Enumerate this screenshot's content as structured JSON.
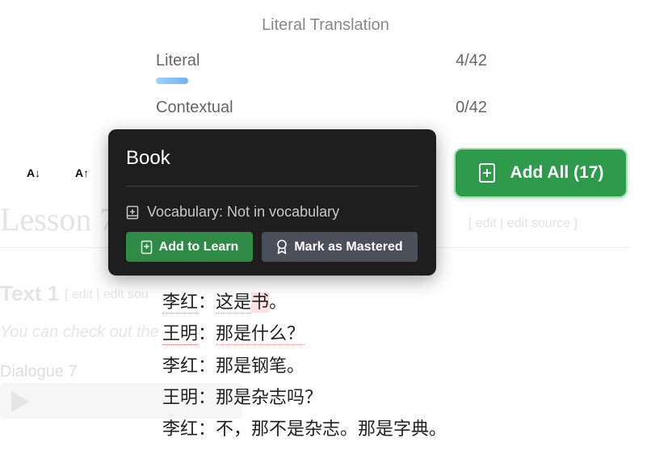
{
  "translation": {
    "title": "Literal Translation",
    "options": [
      {
        "label": "Literal",
        "count": "4/42"
      },
      {
        "label": "Contextual",
        "count": "0/42"
      }
    ],
    "progress": 0.095
  },
  "font_controls": {
    "decrease": "A↓",
    "increase": "A↑"
  },
  "popover": {
    "word": "Book",
    "vocab_status": "Vocabulary: Not in vocabulary",
    "add_label": "Add to Learn",
    "master_label": "Mark as Mastered"
  },
  "add_all": {
    "label": "Add All (17)"
  },
  "lesson": {
    "title": "Lesson 7",
    "title_edit": "[ edit | edit source ]",
    "text_heading": "Text 1",
    "text_edit": "[ edit | edit sou",
    "subtitle": "You can check out the",
    "dialogue_label": "Dialogue 7"
  },
  "dialogue": [
    {
      "speaker": "李红",
      "sep": "：",
      "pre": "这是",
      "hl": "书",
      "post": "。"
    },
    {
      "speaker": "王明",
      "sep": "：",
      "pre": "那是什么？",
      "hl": "",
      "post": ""
    },
    {
      "speaker": "李红",
      "sep": "：",
      "pre": "那是钢笔。",
      "hl": "",
      "post": ""
    },
    {
      "speaker": "王明",
      "sep": "：",
      "pre": "那是杂志吗？",
      "hl": "",
      "post": ""
    },
    {
      "speaker": "李红",
      "sep": "：",
      "pre": "不，那不是杂志。那是字典。",
      "hl": "",
      "post": ""
    }
  ],
  "icons": {
    "popover_vocab": "book-icon",
    "popover_add": "book-plus-icon",
    "popover_master": "award-icon",
    "add_all": "book-plus-icon",
    "player": "play-icon"
  }
}
